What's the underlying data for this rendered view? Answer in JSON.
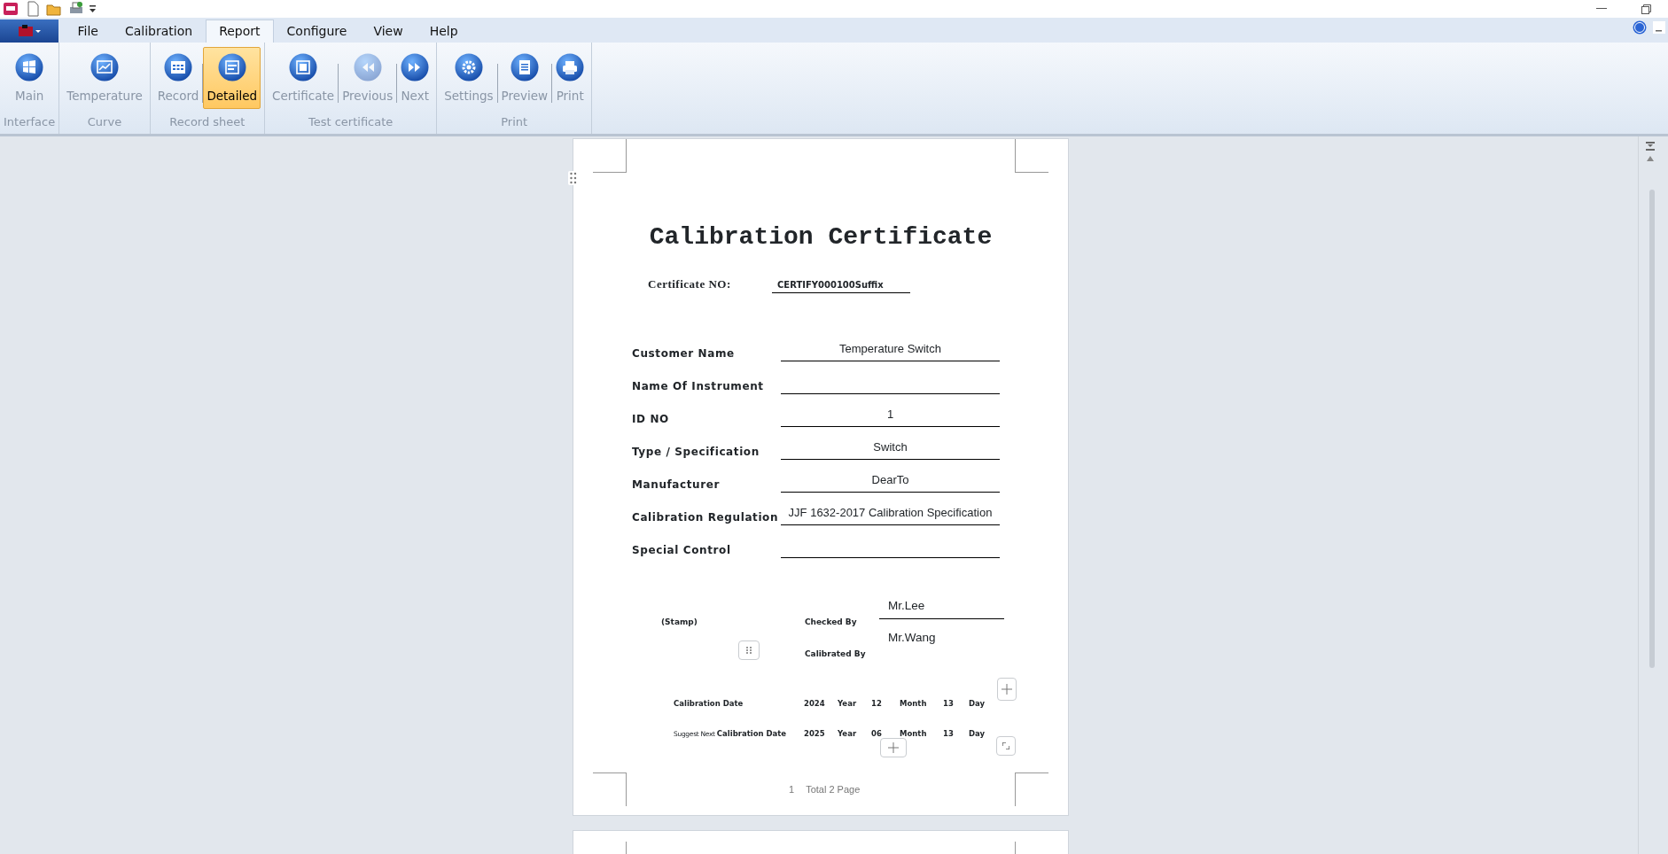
{
  "menu_tabs": [
    {
      "label": "File",
      "selected": false
    },
    {
      "label": "Calibration",
      "selected": false
    },
    {
      "label": "Report",
      "selected": true
    },
    {
      "label": "Configure",
      "selected": false
    },
    {
      "label": "View",
      "selected": false
    },
    {
      "label": "Help",
      "selected": false
    }
  ],
  "ribbon_groups": [
    {
      "label": "Interface",
      "buttons": [
        {
          "label": "Main",
          "kind": "windows",
          "selected": false,
          "disabled": false
        }
      ]
    },
    {
      "label": "Curve",
      "buttons": [
        {
          "label": "Temperature",
          "kind": "chart",
          "selected": false,
          "disabled": false
        }
      ]
    },
    {
      "label": "Record sheet",
      "buttons": [
        {
          "label": "Record",
          "kind": "calendar",
          "selected": false,
          "disabled": false
        },
        {
          "label": "Detailed",
          "kind": "detail",
          "selected": true,
          "disabled": false
        }
      ]
    },
    {
      "label": "Test certificate",
      "buttons": [
        {
          "label": "Certificate",
          "kind": "frame",
          "selected": false,
          "disabled": false
        },
        {
          "label": "Previous",
          "kind": "rewind",
          "selected": false,
          "disabled": true
        },
        {
          "label": "Next",
          "kind": "forward",
          "selected": false,
          "disabled": false
        }
      ]
    },
    {
      "label": "Print",
      "buttons": [
        {
          "label": "Settings",
          "kind": "gear",
          "selected": false,
          "disabled": false
        },
        {
          "label": "Preview",
          "kind": "document",
          "selected": false,
          "disabled": false
        },
        {
          "label": "Print",
          "kind": "printer",
          "selected": false,
          "disabled": false
        }
      ]
    }
  ],
  "certificate": {
    "title": "Calibration Certificate",
    "number_label": "Certificate NO:",
    "number_value": "CERTIFY000100Suffix",
    "fields": [
      {
        "label": "Customer Name",
        "value": "Temperature Switch"
      },
      {
        "label": "Name Of Instrument"
      },
      {
        "label": "ID NO",
        "value": "1"
      },
      {
        "label": "Type / Specification",
        "value": "Switch"
      },
      {
        "label": "Manufacturer",
        "value": "DearTo"
      },
      {
        "label": "Calibration Regulation",
        "value": "JJF 1632-2017 Calibration Specification"
      },
      {
        "label": "Special Control"
      }
    ],
    "stamp_label": "(Stamp)",
    "checked_by_label": "Checked By",
    "checked_by": "Mr.Lee",
    "calibrated_by_label": "Calibrated By",
    "calibrated_by": "Mr.Wang",
    "dates": [
      {
        "label": "Calibration Date",
        "year": "2024",
        "year_unit": "Year",
        "month": "12",
        "month_unit": "Month",
        "day": "13",
        "day_unit": "Day"
      },
      {
        "prefix": "Suggest Next",
        "label": "Calibration  Date",
        "year": "2025",
        "year_unit": "Year",
        "month": "06",
        "month_unit": "Month",
        "day": "13",
        "day_unit": "Day"
      }
    ],
    "page_number": "1",
    "page_total": "Total 2 Page"
  }
}
